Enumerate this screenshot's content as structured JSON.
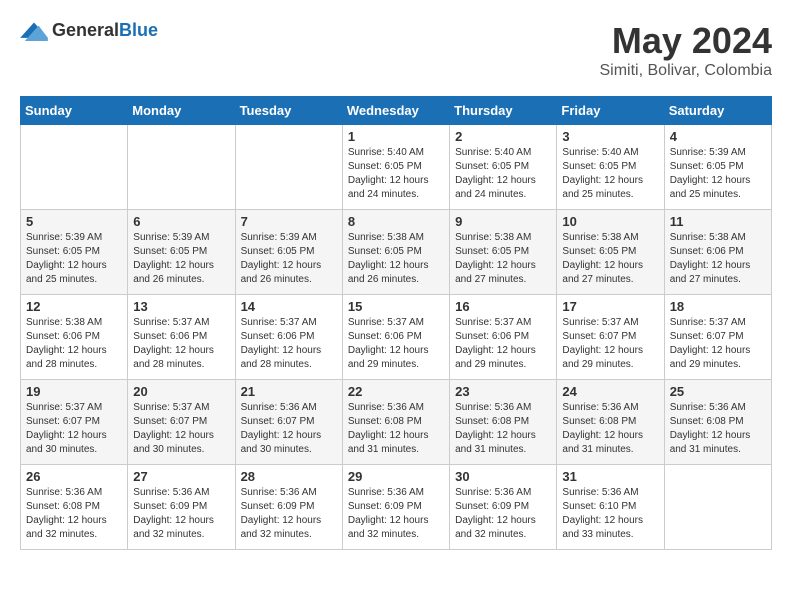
{
  "header": {
    "logo_general": "General",
    "logo_blue": "Blue",
    "month_year": "May 2024",
    "location": "Simiti, Bolivar, Colombia"
  },
  "days_of_week": [
    "Sunday",
    "Monday",
    "Tuesday",
    "Wednesday",
    "Thursday",
    "Friday",
    "Saturday"
  ],
  "weeks": [
    [
      {
        "day": "",
        "info": ""
      },
      {
        "day": "",
        "info": ""
      },
      {
        "day": "",
        "info": ""
      },
      {
        "day": "1",
        "info": "Sunrise: 5:40 AM\nSunset: 6:05 PM\nDaylight: 12 hours\nand 24 minutes."
      },
      {
        "day": "2",
        "info": "Sunrise: 5:40 AM\nSunset: 6:05 PM\nDaylight: 12 hours\nand 24 minutes."
      },
      {
        "day": "3",
        "info": "Sunrise: 5:40 AM\nSunset: 6:05 PM\nDaylight: 12 hours\nand 25 minutes."
      },
      {
        "day": "4",
        "info": "Sunrise: 5:39 AM\nSunset: 6:05 PM\nDaylight: 12 hours\nand 25 minutes."
      }
    ],
    [
      {
        "day": "5",
        "info": "Sunrise: 5:39 AM\nSunset: 6:05 PM\nDaylight: 12 hours\nand 25 minutes."
      },
      {
        "day": "6",
        "info": "Sunrise: 5:39 AM\nSunset: 6:05 PM\nDaylight: 12 hours\nand 26 minutes."
      },
      {
        "day": "7",
        "info": "Sunrise: 5:39 AM\nSunset: 6:05 PM\nDaylight: 12 hours\nand 26 minutes."
      },
      {
        "day": "8",
        "info": "Sunrise: 5:38 AM\nSunset: 6:05 PM\nDaylight: 12 hours\nand 26 minutes."
      },
      {
        "day": "9",
        "info": "Sunrise: 5:38 AM\nSunset: 6:05 PM\nDaylight: 12 hours\nand 27 minutes."
      },
      {
        "day": "10",
        "info": "Sunrise: 5:38 AM\nSunset: 6:05 PM\nDaylight: 12 hours\nand 27 minutes."
      },
      {
        "day": "11",
        "info": "Sunrise: 5:38 AM\nSunset: 6:06 PM\nDaylight: 12 hours\nand 27 minutes."
      }
    ],
    [
      {
        "day": "12",
        "info": "Sunrise: 5:38 AM\nSunset: 6:06 PM\nDaylight: 12 hours\nand 28 minutes."
      },
      {
        "day": "13",
        "info": "Sunrise: 5:37 AM\nSunset: 6:06 PM\nDaylight: 12 hours\nand 28 minutes."
      },
      {
        "day": "14",
        "info": "Sunrise: 5:37 AM\nSunset: 6:06 PM\nDaylight: 12 hours\nand 28 minutes."
      },
      {
        "day": "15",
        "info": "Sunrise: 5:37 AM\nSunset: 6:06 PM\nDaylight: 12 hours\nand 29 minutes."
      },
      {
        "day": "16",
        "info": "Sunrise: 5:37 AM\nSunset: 6:06 PM\nDaylight: 12 hours\nand 29 minutes."
      },
      {
        "day": "17",
        "info": "Sunrise: 5:37 AM\nSunset: 6:07 PM\nDaylight: 12 hours\nand 29 minutes."
      },
      {
        "day": "18",
        "info": "Sunrise: 5:37 AM\nSunset: 6:07 PM\nDaylight: 12 hours\nand 29 minutes."
      }
    ],
    [
      {
        "day": "19",
        "info": "Sunrise: 5:37 AM\nSunset: 6:07 PM\nDaylight: 12 hours\nand 30 minutes."
      },
      {
        "day": "20",
        "info": "Sunrise: 5:37 AM\nSunset: 6:07 PM\nDaylight: 12 hours\nand 30 minutes."
      },
      {
        "day": "21",
        "info": "Sunrise: 5:36 AM\nSunset: 6:07 PM\nDaylight: 12 hours\nand 30 minutes."
      },
      {
        "day": "22",
        "info": "Sunrise: 5:36 AM\nSunset: 6:08 PM\nDaylight: 12 hours\nand 31 minutes."
      },
      {
        "day": "23",
        "info": "Sunrise: 5:36 AM\nSunset: 6:08 PM\nDaylight: 12 hours\nand 31 minutes."
      },
      {
        "day": "24",
        "info": "Sunrise: 5:36 AM\nSunset: 6:08 PM\nDaylight: 12 hours\nand 31 minutes."
      },
      {
        "day": "25",
        "info": "Sunrise: 5:36 AM\nSunset: 6:08 PM\nDaylight: 12 hours\nand 31 minutes."
      }
    ],
    [
      {
        "day": "26",
        "info": "Sunrise: 5:36 AM\nSunset: 6:08 PM\nDaylight: 12 hours\nand 32 minutes."
      },
      {
        "day": "27",
        "info": "Sunrise: 5:36 AM\nSunset: 6:09 PM\nDaylight: 12 hours\nand 32 minutes."
      },
      {
        "day": "28",
        "info": "Sunrise: 5:36 AM\nSunset: 6:09 PM\nDaylight: 12 hours\nand 32 minutes."
      },
      {
        "day": "29",
        "info": "Sunrise: 5:36 AM\nSunset: 6:09 PM\nDaylight: 12 hours\nand 32 minutes."
      },
      {
        "day": "30",
        "info": "Sunrise: 5:36 AM\nSunset: 6:09 PM\nDaylight: 12 hours\nand 32 minutes."
      },
      {
        "day": "31",
        "info": "Sunrise: 5:36 AM\nSunset: 6:10 PM\nDaylight: 12 hours\nand 33 minutes."
      },
      {
        "day": "",
        "info": ""
      }
    ]
  ]
}
